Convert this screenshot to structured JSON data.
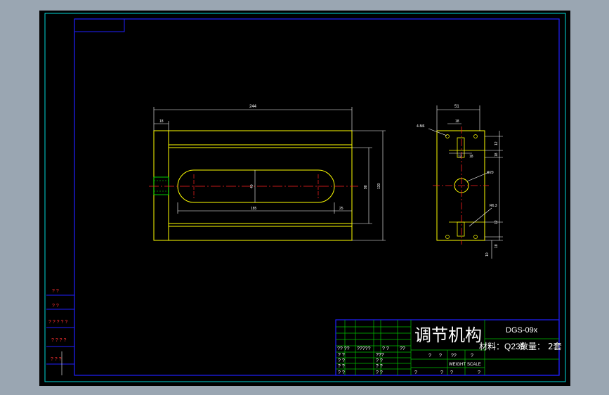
{
  "title_block": {
    "part_name": "调节机构",
    "drawing_no": "DGS-09x",
    "material_label": "材料：",
    "material_value": "Q235",
    "quantity_label": "数量：",
    "quantity_value": "2套",
    "weight_label": "WEIGHT",
    "scale_label": "SCALE",
    "placeholder_row": [
      "?? ??",
      "?????",
      "? ?",
      "??"
    ],
    "grid_marks": [
      "? ?",
      "? ?",
      "? ?",
      "? ?"
    ],
    "grid_marks_mid": [
      "???",
      "? ?",
      "? ?",
      "? ?"
    ],
    "bottom_row": [
      "?",
      "?",
      "?",
      "?",
      "?",
      "?"
    ],
    "small_marks": [
      "??",
      "?",
      "?"
    ]
  },
  "left_strip": {
    "rows": [
      "? ?",
      "? ?",
      "? ? ? ? ?",
      "? ? ? ?",
      "? ? ?"
    ]
  },
  "front_view": {
    "dims": {
      "overall_width": "244",
      "left_offset": "18",
      "slot_length": "185",
      "slot_end": "25",
      "slot_width": "40",
      "inner_height": "98",
      "outer_height": "130"
    }
  },
  "side_view": {
    "dims": {
      "width": "51",
      "hole_label": "4-M6",
      "hole_offset": "18",
      "step_a": "12",
      "step_b": "18",
      "center_hole": "Φ20",
      "roughness": "R6.3",
      "right_1": "12",
      "right_2": "18",
      "right_3": "12",
      "right_4": "18",
      "right_5": "10"
    }
  },
  "colors": {
    "background": "#000000",
    "frame": "#00ffff",
    "border": "#0000ff",
    "geometry": "#ffff00",
    "dimension": "#ffffff",
    "centerline": "#ff0000",
    "title_grid": "#00ff00"
  }
}
